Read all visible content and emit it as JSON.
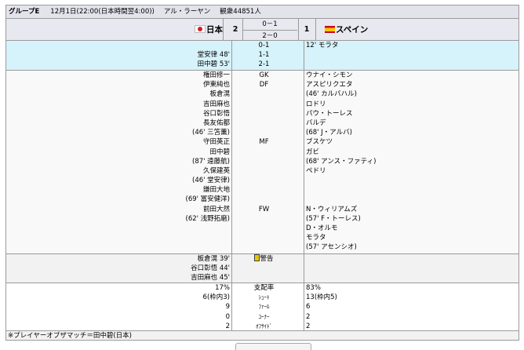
{
  "header": {
    "group": "グループE",
    "datetime": "12月1日(22:00(日本時間翌4:00))",
    "venue": "アル・ラーヤン",
    "attendance": "観衆44851人"
  },
  "match": {
    "home_team": "日本",
    "home_score": "2",
    "away_team": "スペイン",
    "away_score": "1",
    "first_half": "0－1",
    "second_half": "2－0"
  },
  "goals": {
    "home": [
      "",
      "堂安律 48'",
      "田中碧 53'"
    ],
    "running": [
      "0-1",
      "1-1",
      "2-1"
    ],
    "away": [
      "12' モラタ",
      "",
      ""
    ]
  },
  "lineup": {
    "home": [
      "権田修一",
      "伊東純也",
      "板倉滉",
      "吉田麻也",
      "谷口彰悟",
      "長友佑都",
      "(46' 三笘薫)",
      "守田英正",
      "田中碧",
      "(87' 遠藤航)",
      "久保建英",
      "(46' 堂安律)",
      "鎌田大地",
      "(69' 冨安健洋)",
      "前田大然",
      "(62' 浅野拓磨)"
    ],
    "positions": [
      "GK",
      "DF",
      "",
      "",
      "",
      "",
      "",
      "MF",
      "",
      "",
      "",
      "",
      "",
      "",
      "FW",
      ""
    ],
    "away": [
      "ウナイ・シモン",
      "アスピリクエタ",
      "(46' カルバハル)",
      "ロドリ",
      "パウ・トーレス",
      "バルデ",
      "(68' J・アルバ)",
      "ブスケツ",
      "ガビ",
      "(68' アンス・ファティ)",
      "ペドリ",
      "",
      "",
      "",
      "N・ウィリアムズ",
      "(57' F・トーレス)",
      "D・オルモ",
      "モラタ",
      "(57' アセンシオ)"
    ]
  },
  "cards": {
    "home": [
      "板倉滉 39'",
      "谷口彰悟 44'",
      "吉田麻也 45'"
    ],
    "label": "警告",
    "away": [
      "",
      "",
      ""
    ]
  },
  "stats": {
    "home": [
      "17%",
      "6(枠内3)",
      "9",
      "0",
      "2"
    ],
    "labels": [
      "支配率",
      "ｼｭｰﾄ",
      "ﾌｧｰﾙ",
      "ｺｰﾅｰ",
      "ｵﾌｻｲﾄﾞ"
    ],
    "away": [
      "83%",
      "13(枠内5)",
      "6",
      "2",
      "2"
    ]
  },
  "footer": {
    "mom": "※プレイヤーオブザマッチ＝田中碧(日本)"
  }
}
